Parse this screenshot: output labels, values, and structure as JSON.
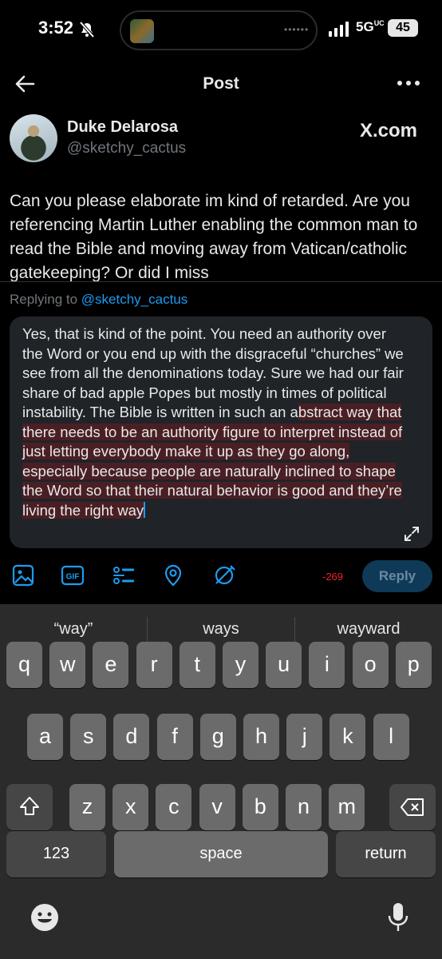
{
  "status_bar": {
    "time": "3:52",
    "network": "5G",
    "network_sub": "UC",
    "battery": "45"
  },
  "header": {
    "title": "Post"
  },
  "post": {
    "author_name": "Duke Delarosa",
    "author_handle": "@sketchy_cactus",
    "watermark": "X.com",
    "text": "Can you please elaborate im kind of retarded. Are you referencing Martin Luther enabling the common man to read the Bible and moving away from Vatican/catholic gatekeeping? Or did I miss"
  },
  "replying": {
    "prefix": "Replying to ",
    "handle": "@sketchy_cactus"
  },
  "composer": {
    "text_normal": "Yes, that is kind of the point. You need an authority over the Word or you end up with the disgraceful “churches” we see from all the denominations today. Sure we had our fair share of bad apple Popes but mostly in times of political instability. The Bible is written in such an a",
    "text_over_limit": "bstract way that there needs to be an authority figure to interpret instead of just letting everybody make it up as they go along, especially because people are naturally inclined to shape the Word so that their natural behavior is good and they’re living the right way"
  },
  "toolbar": {
    "icons": [
      "image-icon",
      "gif-icon",
      "poll-icon",
      "location-icon",
      "schedule-icon"
    ],
    "gif_label": "GIF",
    "counter": "-269",
    "reply_label": "Reply"
  },
  "keyboard": {
    "suggestions": [
      "“way”",
      "ways",
      "wayward"
    ],
    "row1": [
      "q",
      "w",
      "e",
      "r",
      "t",
      "y",
      "u",
      "i",
      "o",
      "p"
    ],
    "row2": [
      "a",
      "s",
      "d",
      "f",
      "g",
      "h",
      "j",
      "k",
      "l"
    ],
    "row3": [
      "z",
      "x",
      "c",
      "v",
      "b",
      "n",
      "m"
    ],
    "numbers_label": "123",
    "space_label": "space",
    "return_label": "return"
  },
  "colors": {
    "accent": "#1d9bf0",
    "over_limit": "#f4212e"
  }
}
